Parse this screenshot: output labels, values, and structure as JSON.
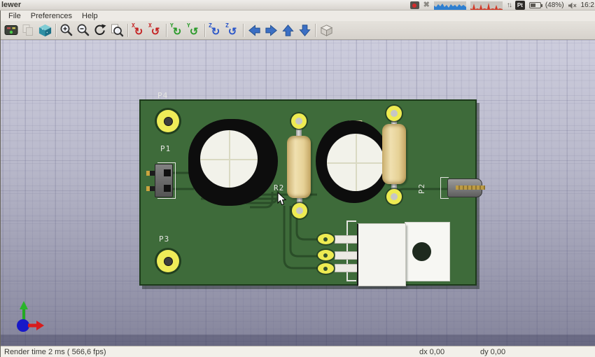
{
  "panel": {
    "window_title": "lewer",
    "clock": "16:2",
    "battery_level": "(48%)",
    "pt_badge": "Pt",
    "icons": {
      "tray_close": "✖",
      "net_arrows": "↑↓"
    }
  },
  "menubar": {
    "items": [
      {
        "label": "File"
      },
      {
        "label": "Preferences"
      },
      {
        "label": "Help"
      }
    ]
  },
  "toolbar": {
    "axis_letters": {
      "x": "X",
      "y": "Y",
      "z": "Z"
    },
    "glyphs": {
      "rotate_cw": "↻",
      "rotate_ccw": "↺"
    }
  },
  "board": {
    "labels": {
      "p4": "P4",
      "p1": "P1",
      "r2": "R2",
      "p2": "P2",
      "p3": "P3"
    },
    "colors": {
      "board_green": "#3e6b3a",
      "trace_green": "#2a4d28",
      "pad_yellow": "#eeeb52",
      "capacitor_body": "#0d0d0d",
      "capacitor_top": "#f2f2ea",
      "resistor_tan": "#e6d196",
      "silkscreen_white": "#e4e4e0"
    }
  },
  "viewport": {
    "background_top": "#cdcddd",
    "background_bottom": "#83839a",
    "axis_colors": {
      "x_red": "#d81c1c",
      "y_green": "#22aa22",
      "z_blue": "#1818c8"
    }
  },
  "statusbar": {
    "render_time": "Render time 2 ms ( 566,6 fps)",
    "dx": "dx 0,00",
    "dy": "dy 0,00"
  }
}
